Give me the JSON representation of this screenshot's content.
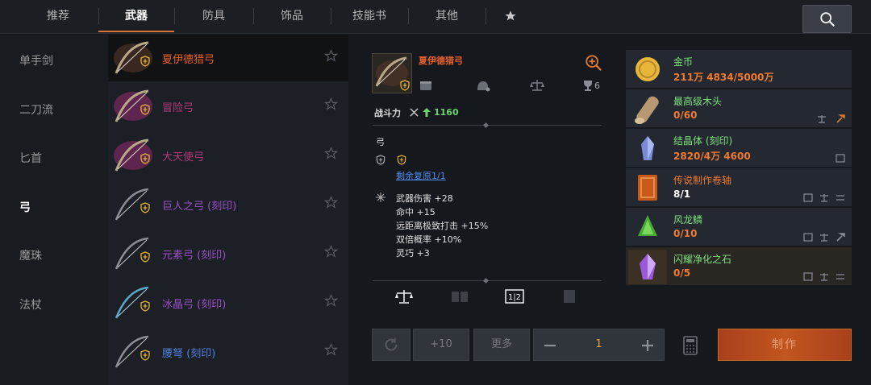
{
  "tabs": [
    {
      "label": "推荐"
    },
    {
      "label": "武器"
    },
    {
      "label": "防具"
    },
    {
      "label": "饰品"
    },
    {
      "label": "技能书"
    },
    {
      "label": "其他"
    }
  ],
  "active_tab_index": 1,
  "categories": [
    {
      "label": "单手剑"
    },
    {
      "label": "二刀流"
    },
    {
      "label": "匕首"
    },
    {
      "label": "弓"
    },
    {
      "label": "魔珠"
    },
    {
      "label": "法杖"
    }
  ],
  "active_category_index": 3,
  "items": [
    {
      "name": "夏伊德猎弓",
      "color": "#e8622b",
      "selected": true
    },
    {
      "name": "冒险弓",
      "color": "#b43a7a",
      "selected": false
    },
    {
      "name": "大天使弓",
      "color": "#b43a7a",
      "selected": false
    },
    {
      "name": "巨人之弓 (刻印)",
      "color": "#9a50c8",
      "selected": false
    },
    {
      "name": "元素弓 (刻印)",
      "color": "#9a50c8",
      "selected": false
    },
    {
      "name": "冰晶弓 (刻印)",
      "color": "#9a50c8",
      "selected": false
    },
    {
      "name": "腰弩 (刻印)",
      "color": "#4d7fd8",
      "selected": false
    }
  ],
  "detail": {
    "name": "夏伊德猎弓",
    "stat_count": "6",
    "power_label": "战斗力",
    "power_value": "1160",
    "weapon_type": "弓",
    "restore_text": "剩余复原1/1",
    "attributes": [
      "武器伤害 +28",
      "命中 +15",
      "远距离极致打击 +15%",
      "双倍概率 +10%",
      "灵巧 +3"
    ]
  },
  "materials": [
    {
      "name": "金币",
      "count": "211万 4834/5000万",
      "icon": "gold-coin-icon",
      "count_white": false,
      "actions": []
    },
    {
      "name": "最高级木头",
      "count": "0/60",
      "icon": "wood-log-icon",
      "count_white": false,
      "actions": [
        "scale-icon",
        "hammer-icon"
      ]
    },
    {
      "name": "结晶体 (刻印)",
      "count": "2820/4万 4600",
      "icon": "crystal-icon",
      "count_white": false,
      "actions": [
        "exchange-icon"
      ]
    },
    {
      "name": "传说制作卷轴",
      "count": "8/1",
      "icon": "scroll-icon",
      "count_white": true,
      "actions": [
        "exchange-icon",
        "scale-icon",
        "swap-icon"
      ]
    },
    {
      "name": "风龙鳞",
      "count": "0/10",
      "icon": "dragon-scale-icon",
      "count_white": false,
      "actions": [
        "exchange-icon",
        "scale-icon",
        "hammer-icon"
      ]
    },
    {
      "name": "闪耀净化之石",
      "count": "0/5",
      "icon": "purify-stone-icon",
      "count_white": false,
      "actions": [
        "exchange-icon",
        "scale-icon",
        "swap-icon"
      ]
    }
  ],
  "controls": {
    "plus10": "+10",
    "more": "更多",
    "quantity": "1",
    "craft": "制作"
  },
  "colors": {
    "accent": "#d9743a",
    "legendary": "#e8622b",
    "epic": "#9a50c8",
    "link": "#4f8ff0",
    "positive": "#6bd36b"
  }
}
